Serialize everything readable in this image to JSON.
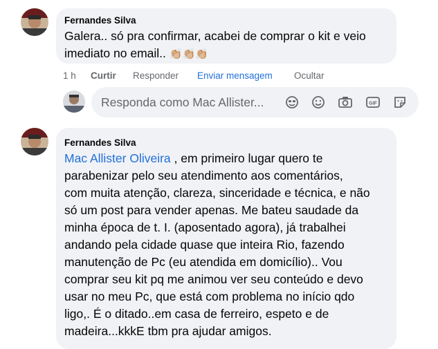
{
  "comment1": {
    "author": "Fernandes Silva",
    "text": "Galera.. só pra confirmar, acabei de comprar o kit e veio imediato no email..",
    "emoji": "👏🏼👏🏼👏🏼"
  },
  "actions": {
    "time": "1 h",
    "like": "Curtir",
    "reply": "Responder",
    "message": "Enviar mensagem",
    "hide": "Ocultar"
  },
  "reply_box": {
    "placeholder": "Responda como Mac Allister...",
    "tools": [
      "avatar-sticker-icon",
      "emoji-icon",
      "camera-icon",
      "gif-icon",
      "sticker-icon"
    ]
  },
  "comment2": {
    "author": "Fernandes Silva",
    "mention": "Mac Allister Oliveira",
    "lines": [
      " , em primeiro lugar quero te",
      "parabenizar pelo seu atendimento aos comentários,",
      "com muita atenção, clareza, sinceridade e técnica, e não",
      "só um post para vender apenas. Me bateu saudade da",
      "minha época de t. I. (aposentado agora), já trabalhei",
      "andando pela cidade quase que inteira Rio, fazendo",
      "manutenção de Pc (eu atendida em domicílio).. Vou",
      "comprar seu kit pq me animou ver seu conteúdo e devo",
      "usar no meu Pc, que está com problema no início qdo",
      "ligo,. É o ditado..em casa de ferreiro, espeto e de",
      "madeira...kkkE tbm pra ajudar amigos."
    ]
  }
}
